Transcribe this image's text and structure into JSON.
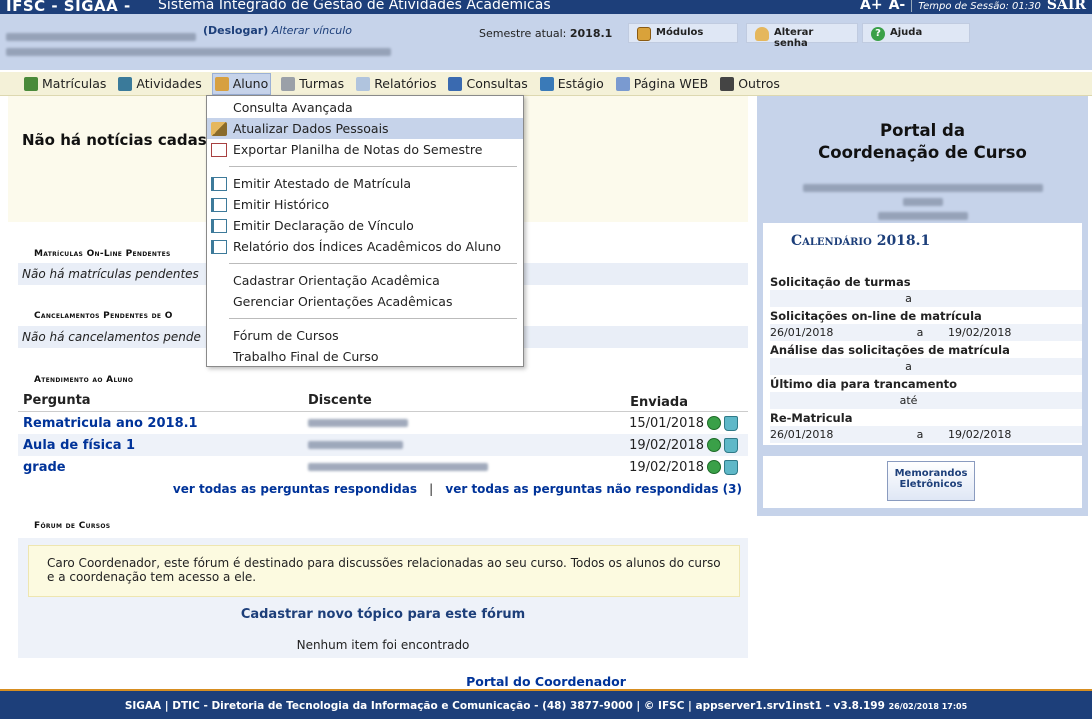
{
  "topbar": {
    "brand": "IFSC - SIGAA -",
    "system": "Sistema Integrado de Gestão de Atividades Acadêmicas",
    "font_up": "A+",
    "font_down": "A-",
    "timer": "Tempo de Sessão: 01:30",
    "sair": "SAIR"
  },
  "info": {
    "logout": "(Deslogar)",
    "vinculo": "Alterar vínculo",
    "semester_label": "Semestre atual:",
    "semester_value": "2018.1",
    "btn_modulos": "Módulos",
    "btn_senha": "Alterar senha",
    "btn_ajuda": "Ajuda"
  },
  "menu": [
    {
      "label": "Matrículas",
      "icon": "registration-icon",
      "color": "#4a8a3a"
    },
    {
      "label": "Atividades",
      "icon": "activities-icon",
      "color": "#3a7a9a"
    },
    {
      "label": "Aluno",
      "icon": "student-icon",
      "color": "#d7a040",
      "active": true
    },
    {
      "label": "Turmas",
      "icon": "classes-icon",
      "color": "#9aa0a8"
    },
    {
      "label": "Relatórios",
      "icon": "reports-icon",
      "color": "#b0c4de"
    },
    {
      "label": "Consultas",
      "icon": "search-icon",
      "color": "#3a6ab0"
    },
    {
      "label": "Estágio",
      "icon": "internship-icon",
      "color": "#3a7ab8"
    },
    {
      "label": "Página WEB",
      "icon": "web-page-icon",
      "color": "#7a9ad0"
    },
    {
      "label": "Outros",
      "icon": "phone-icon",
      "color": "#444"
    }
  ],
  "dropdown": {
    "consulta": "Consulta Avançada",
    "atualizar": "Atualizar Dados Pessoais",
    "exportar": "Exportar Planilha de Notas do Semestre",
    "atestado": "Emitir Atestado de Matrícula",
    "historico": "Emitir Histórico",
    "declaracao": "Emitir Declaração de Vínculo",
    "indices": "Relatório dos Índices Acadêmicos do Aluno",
    "cad_orientacao": "Cadastrar Orientação Acadêmica",
    "ger_orientacao": "Gerenciar Orientações Acadêmicas",
    "forum": "Fórum de Cursos",
    "tcc": "Trabalho Final de Curso"
  },
  "news": {
    "title": "Não há notícias cadast"
  },
  "matriculas": {
    "label": "Matrículas On-Line Pendentes",
    "empty": "Não há matrículas pendentes"
  },
  "cancelamentos": {
    "label": "Cancelamentos Pendentes de O",
    "empty": "Não há cancelamentos pende"
  },
  "atendimento": {
    "label": "Atendimento ao Aluno",
    "col_pergunta": "Pergunta",
    "col_discente": "Discente",
    "col_enviada": "Enviada",
    "rows": [
      {
        "pergunta": "Rematricula ano 2018.1",
        "enviada": "15/01/2018"
      },
      {
        "pergunta": "Aula de física 1",
        "enviada": "19/02/2018"
      },
      {
        "pergunta": "grade",
        "enviada": "19/02/2018"
      }
    ],
    "link_respondidas": "ver todas as perguntas respondidas",
    "sep": "|",
    "link_nao_respondidas": "ver todas as perguntas não respondidas (3)"
  },
  "forum": {
    "label": "Fórum de Cursos",
    "message": "Caro Coordenador, este fórum é destinado para discussões relacionadas ao seu curso. Todos os alunos do curso e a coordenação tem acesso a ele.",
    "new_topic": "Cadastrar novo tópico para este fórum",
    "empty": "Nenhum item foi encontrado"
  },
  "portal_link": "Portal do Coordenador",
  "footer": {
    "text": "SIGAA | DTIC - Diretoria de Tecnologia da Informação e Comunicação - (48) 3877-9000 | © IFSC | appserver1.srv1inst1 - v3.8.199",
    "date": "26/02/2018 17:05"
  },
  "portal": {
    "title_line1": "Portal da",
    "title_line2": "Coordenação de Curso",
    "calendar_label": "Calendário",
    "calendar_year": "2018.1",
    "calendar": [
      {
        "label": "Solicitação de turmas",
        "start": "",
        "mid": "a",
        "end": ""
      },
      {
        "label": "Solicitações on-line de matrícula",
        "start": "26/01/2018",
        "mid": "a",
        "end": "19/02/2018"
      },
      {
        "label": "Análise das solicitações de matrícula",
        "start": "",
        "mid": "a",
        "end": ""
      },
      {
        "label": "Último dia para trancamento",
        "start": "",
        "mid": "até",
        "end": ""
      },
      {
        "label": "Re-Matricula",
        "start": "26/01/2018",
        "mid": "a",
        "end": "19/02/2018"
      }
    ],
    "memo_line1": "Memorandos",
    "memo_line2": "Eletrônicos"
  }
}
